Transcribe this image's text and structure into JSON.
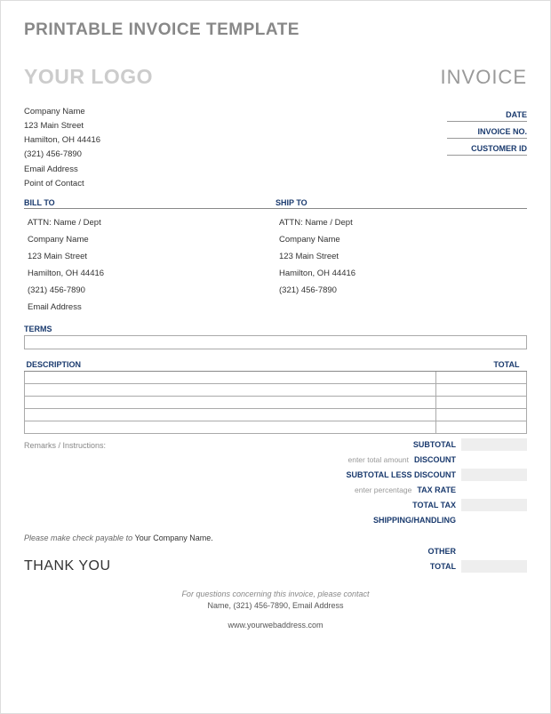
{
  "page_title": "PRINTABLE INVOICE TEMPLATE",
  "logo_text": "YOUR LOGO",
  "invoice_label": "INVOICE",
  "company": {
    "name": "Company Name",
    "street": "123 Main Street",
    "city": "Hamilton, OH 44416",
    "phone": "(321) 456-7890",
    "email": "Email Address",
    "poc": "Point of Contact"
  },
  "meta": {
    "date": "DATE",
    "invoice_no": "INVOICE NO.",
    "customer_id": "CUSTOMER ID"
  },
  "bill_to": {
    "header": "BILL TO",
    "attn": "ATTN: Name / Dept",
    "company": "Company Name",
    "street": "123 Main Street",
    "city": "Hamilton, OH 44416",
    "phone": "(321) 456-7890",
    "email": "Email Address"
  },
  "ship_to": {
    "header": "SHIP TO",
    "attn": "ATTN: Name / Dept",
    "company": "Company Name",
    "street": "123 Main Street",
    "city": "Hamilton, OH 44416",
    "phone": "(321) 456-7890"
  },
  "terms_label": "TERMS",
  "table": {
    "desc_header": "DESCRIPTION",
    "total_header": "TOTAL"
  },
  "remarks_label": "Remarks / Instructions:",
  "totals": {
    "subtotal": "SUBTOTAL",
    "discount_hint": "enter total amount",
    "discount": "DISCOUNT",
    "subtotal_less": "SUBTOTAL LESS DISCOUNT",
    "taxrate_hint": "enter percentage",
    "taxrate": "TAX RATE",
    "totaltax": "TOTAL TAX",
    "shipping": "SHIPPING/HANDLING",
    "other": "OTHER",
    "total": "TOTAL"
  },
  "payable": {
    "prefix": "Please make check payable to",
    "company": "Your Company Name."
  },
  "thanks": "THANK YOU",
  "footer": {
    "q": "For questions concerning this invoice, please contact",
    "contact": "Name, (321) 456-7890, Email Address",
    "web": "www.yourwebaddress.com"
  }
}
